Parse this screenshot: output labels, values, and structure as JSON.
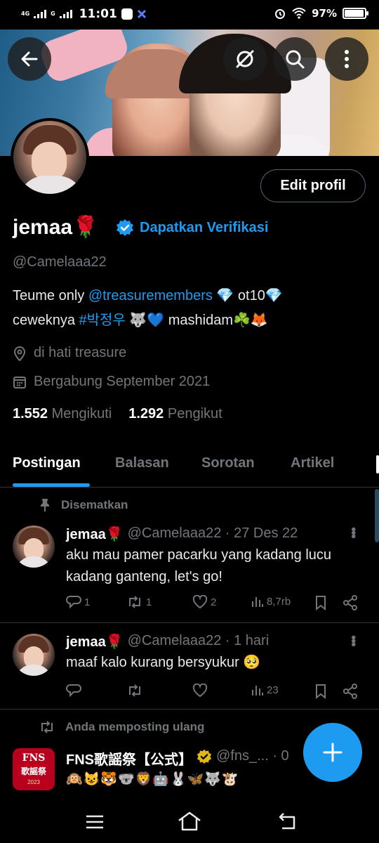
{
  "status_bar": {
    "net1": "4G",
    "net2": "G",
    "time": "11:01",
    "battery": "97%",
    "battery_level": 0.97
  },
  "header": {
    "back_icon": "arrow-left-icon",
    "buttons": [
      "grok-icon",
      "search-icon",
      "more-vertical-icon"
    ]
  },
  "profile": {
    "edit_button": "Edit profil",
    "name": "jemaa🌹",
    "verify_link": "Dapatkan Verifikasi",
    "handle": "@Camelaaa22",
    "bio_line1_a": "Teume only ",
    "bio_line1_link": "@treasuremembers",
    "bio_line1_b": " 💎 ot10💎",
    "bio_line2_a": "ceweknya ",
    "bio_line2_link": "#박정우",
    "bio_line2_b": " 🐺💙 mashidam☘️🦊",
    "location": "di hati treasure",
    "joined": "Bergabung September 2021",
    "following_count": "1.552",
    "following_label": "Mengikuti",
    "followers_count": "1.292",
    "followers_label": "Pengikut"
  },
  "tabs": [
    "Postingan",
    "Balasan",
    "Sorotan",
    "Artikel"
  ],
  "posts": [
    {
      "context": "Disematkan",
      "name": "jemaa🌹",
      "meta": "@Camelaaa22 · 27 Des 22",
      "text": "aku mau pamer pacarku yang kadang lucu kadang ganteng, let's go!",
      "replies": "1",
      "reposts": "1",
      "likes": "2",
      "views": "8,7rb"
    },
    {
      "name": "jemaa🌹",
      "meta": "@Camelaaa22 · 1 hari",
      "text": "maaf kalo kurang bersyukur 🥺",
      "replies": "",
      "reposts": "",
      "likes": "",
      "views": "23"
    },
    {
      "context": "Anda memposting ulang",
      "name": "FNS歌謡祭【公式】",
      "meta": "@fns_... · 0",
      "avatar_text1": "FNS",
      "avatar_text2": "歌謡祭",
      "avatar_text3": "2023",
      "text": "🙉😺🐯🐨🦁🤖🐰🦋🐺🐮"
    }
  ],
  "colors": {
    "accent": "#1d9bf0",
    "muted": "#71767b",
    "background": "#000000",
    "text": "#e7e9ea"
  }
}
